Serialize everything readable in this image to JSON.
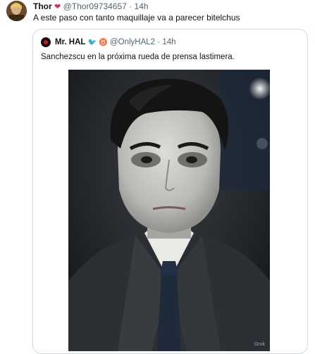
{
  "tweet": {
    "author_name": "Thor",
    "heart": "❤",
    "handle": "@Thor09734657",
    "separator": "·",
    "time": "14h",
    "text": "A este paso con tanto maquillaje va a parecer bitelchus"
  },
  "quote": {
    "author_name": "Mr. HAL",
    "badge_bird": "🐦",
    "badge_taurus": "♉",
    "handle": "@OnlyHAL2",
    "separator": "·",
    "time": "14h",
    "text": "Sanchezscu en la próxima rueda de prensa lastimera.",
    "image_watermark": "Grok"
  },
  "colors": {
    "text_primary": "#0f1419",
    "text_secondary": "#536471",
    "border": "#cfd9de",
    "heart": "#e0245e"
  },
  "icons": {
    "heart": "red-heart-icon",
    "bird": "bird-icon",
    "taurus": "taurus-icon"
  }
}
